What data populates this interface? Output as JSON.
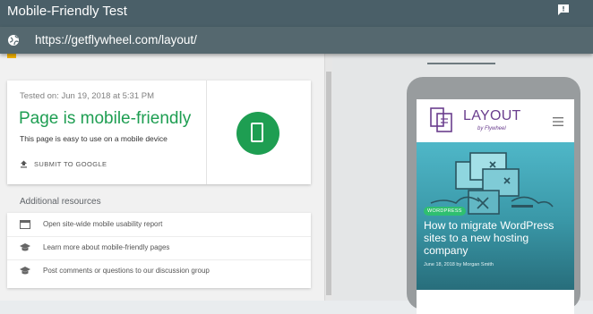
{
  "app": {
    "title": "Mobile-Friendly Test"
  },
  "urlbar": {
    "url": "https://getflywheel.com/layout/"
  },
  "icons": {
    "feedback": "feedback-icon",
    "globe": "globe-icon",
    "upload": "upload-icon",
    "phone": "smartphone-icon",
    "web": "web-window-icon",
    "school": "graduation-cap-icon",
    "menu": "hamburger-menu-icon"
  },
  "colors": {
    "header": "#4a5f68",
    "success": "#1e9e52",
    "logo": "#6a3e8e",
    "tag": "#2fbf70",
    "hero": "#3a98a8"
  },
  "result": {
    "tested_on": "Tested on: Jun 19, 2018 at 5:31 PM",
    "verdict": "Page is mobile-friendly",
    "description": "This page is easy to use on a mobile device",
    "submit_label": "SUBMIT TO GOOGLE"
  },
  "resources": {
    "title": "Additional resources",
    "items": [
      {
        "label": "Open site-wide mobile usability report",
        "icon": "web-window-icon"
      },
      {
        "label": "Learn more about mobile-friendly pages",
        "icon": "graduation-cap-icon"
      },
      {
        "label": "Post comments or questions to our discussion group",
        "icon": "graduation-cap-icon"
      }
    ]
  },
  "preview": {
    "logo_text": "LAYOUT",
    "logo_sub": "by Flywheel",
    "tag": "WORDPRESS",
    "article_title": "How to migrate WordPress sites to a new hosting company",
    "article_meta": "June 18, 2018 by Morgan Smith"
  }
}
